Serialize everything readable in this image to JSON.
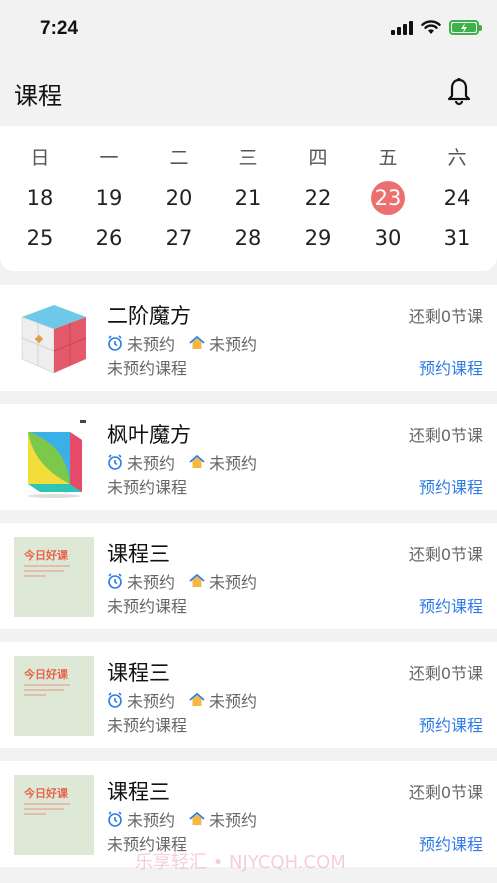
{
  "status_bar": {
    "time": "7:24"
  },
  "header": {
    "title": "课程"
  },
  "calendar": {
    "weekdays": [
      "日",
      "一",
      "二",
      "三",
      "四",
      "五",
      "六"
    ],
    "week1": [
      "18",
      "19",
      "20",
      "21",
      "22",
      "23",
      "24"
    ],
    "week2": [
      "25",
      "26",
      "27",
      "28",
      "29",
      "30",
      "31"
    ],
    "today": "23",
    "today_color": "#ec7070"
  },
  "courses": [
    {
      "name": "二阶魔方",
      "remaining": "还剩0节课",
      "time_status": "未预约",
      "place_status": "未预约",
      "note": "未预约课程",
      "action": "预约课程",
      "thumb": "2x2-cube"
    },
    {
      "name": "枫叶魔方",
      "remaining": "还剩0节课",
      "time_status": "未预约",
      "place_status": "未预约",
      "note": "未预约课程",
      "action": "预约课程",
      "thumb": "maple-cube"
    },
    {
      "name": "课程三",
      "remaining": "还剩0节课",
      "time_status": "未预约",
      "place_status": "未预约",
      "note": "未预约课程",
      "action": "预约课程",
      "thumb": "today-good-course",
      "thumb_title": "今日好课"
    },
    {
      "name": "课程三",
      "remaining": "还剩0节课",
      "time_status": "未预约",
      "place_status": "未预约",
      "note": "未预约课程",
      "action": "预约课程",
      "thumb": "today-good-course",
      "thumb_title": "今日好课"
    },
    {
      "name": "课程三",
      "remaining": "还剩0节课",
      "time_status": "未预约",
      "place_status": "未预约",
      "note": "未预约课程",
      "action": "预约课程",
      "thumb": "today-good-course",
      "thumb_title": "今日好课"
    }
  ],
  "watermark": "乐享轻汇 • NJYCQH.COM",
  "colors": {
    "accent": "#2e7be6",
    "today": "#ec7070",
    "battery": "#3fb14a"
  }
}
